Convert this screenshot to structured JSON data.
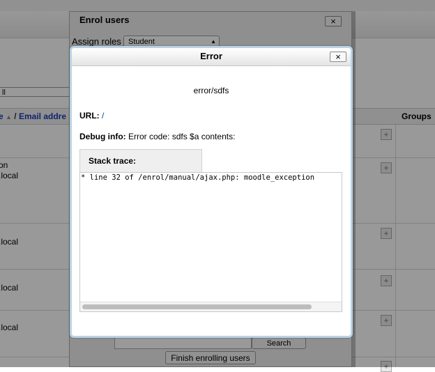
{
  "background": {
    "filter_value": "ll",
    "columns": {
      "name_fragment": "e",
      "separator": "/",
      "email_header": "Email addre",
      "groups_header": "Groups"
    },
    "rows": [
      {
        "line1": "on",
        "line2": ".local"
      },
      {
        "line1": "",
        "line2": ".local"
      },
      {
        "line1": "",
        "line2": ".local"
      },
      {
        "line1": "",
        "line2": ".local"
      }
    ],
    "add_group_symbol": "+"
  },
  "enrol_dialog": {
    "title": "Enrol users",
    "close_symbol": "×",
    "assign_roles_label": "Assign roles",
    "assign_roles_value": "Student",
    "search_button": "Search",
    "finish_button": "Finish enrolling users"
  },
  "error_dialog": {
    "title": "Error",
    "close_symbol": "×",
    "message": "error/sdfs",
    "url_label": "URL:",
    "url_value": "/",
    "debug_label": "Debug info:",
    "debug_value": "Error code: sdfs $a contents:",
    "stack_label": "Stack trace:",
    "stack_trace": "* line 32 of /enrol/manual/ajax.php: moodle_exception"
  }
}
